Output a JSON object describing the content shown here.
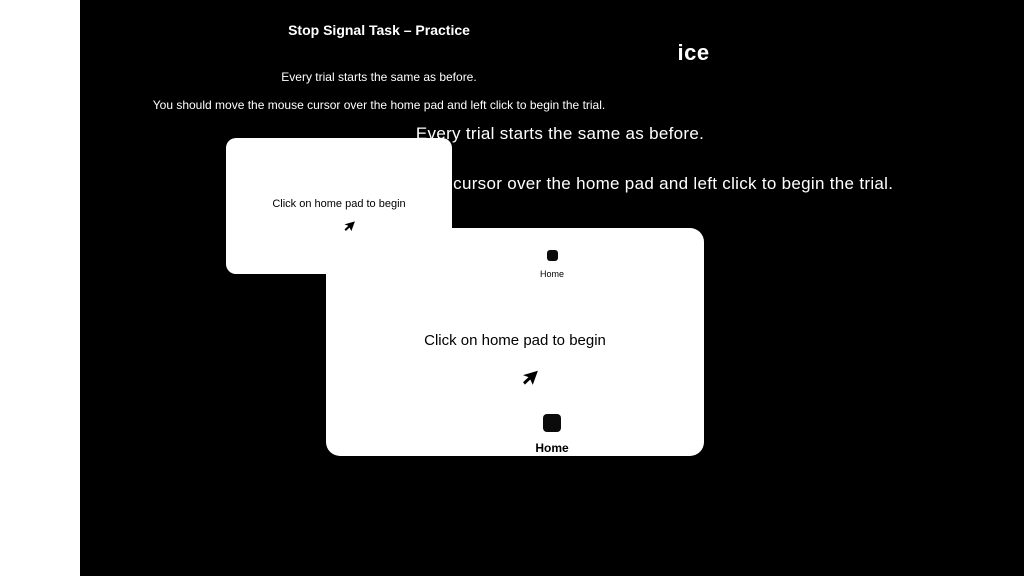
{
  "title": "Stop Signal Task – Practice",
  "line1": "Every trial starts the same as before.",
  "line2": "You should move the mouse cursor over the home pad and left click to begin the trial.",
  "card": {
    "prompt": "Click on home pad to begin",
    "home_label": "Home"
  }
}
